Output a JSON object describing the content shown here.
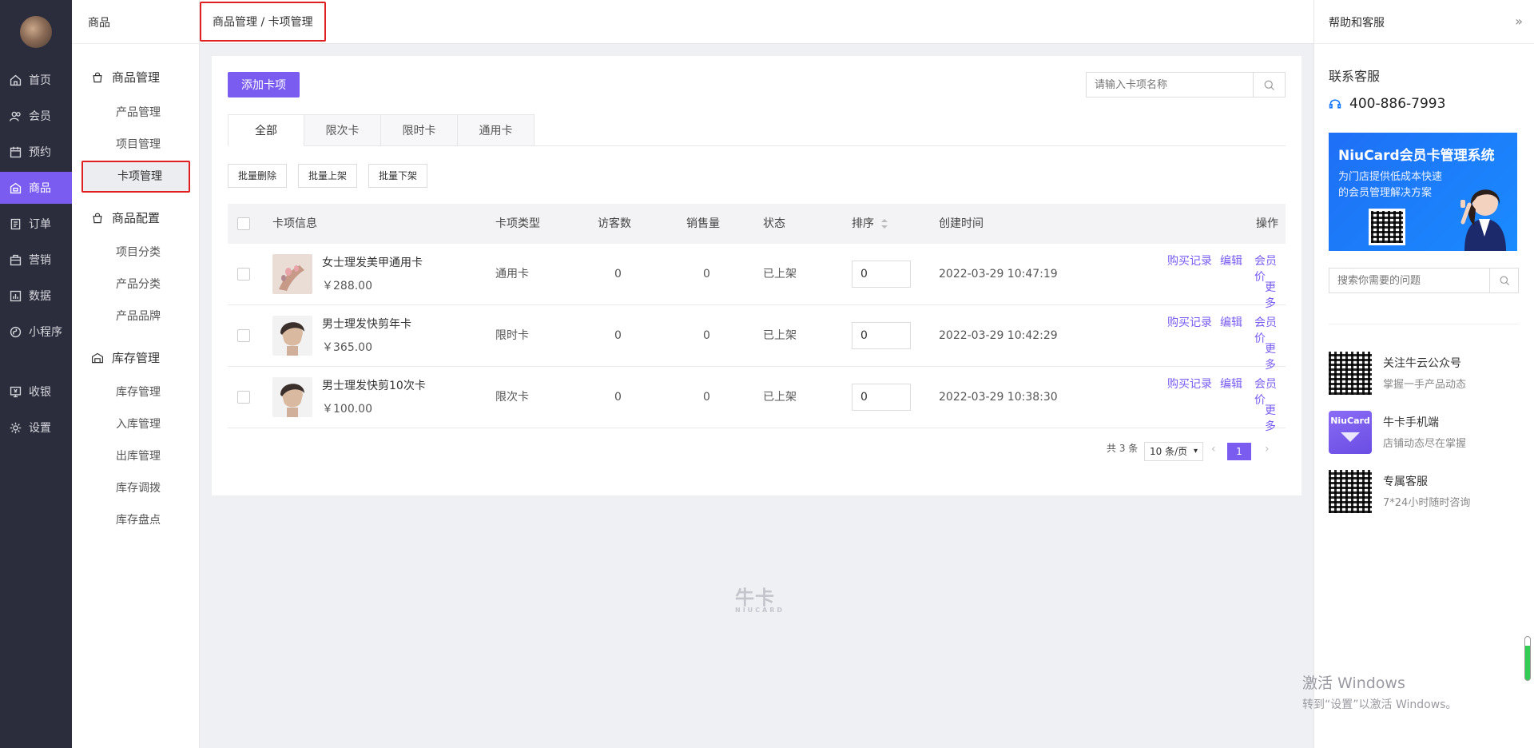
{
  "nav": {
    "items": [
      {
        "label": "首页",
        "icon": "home-icon"
      },
      {
        "label": "会员",
        "icon": "users-icon"
      },
      {
        "label": "预约",
        "icon": "calendar-icon"
      },
      {
        "label": "商品",
        "icon": "store-icon"
      },
      {
        "label": "订单",
        "icon": "order-icon"
      },
      {
        "label": "营销",
        "icon": "marketing-icon"
      },
      {
        "label": "数据",
        "icon": "chart-icon"
      },
      {
        "label": "小程序",
        "icon": "miniapp-icon"
      },
      {
        "label": "收银",
        "icon": "cashier-icon"
      },
      {
        "label": "设置",
        "icon": "gear-icon"
      }
    ],
    "active_color": "#7a5cf0"
  },
  "sidebar": {
    "title": "商品",
    "groups": [
      {
        "label": "商品管理",
        "items": [
          "产品管理",
          "项目管理",
          "卡项管理"
        ]
      },
      {
        "label": "商品配置",
        "items": [
          "项目分类",
          "产品分类",
          "产品品牌"
        ]
      },
      {
        "label": "库存管理",
        "items": [
          "库存管理",
          "入库管理",
          "出库管理",
          "库存调拨",
          "库存盘点"
        ]
      }
    ],
    "active_item": "卡项管理"
  },
  "header": {
    "breadcrumb": "商品管理 / 卡项管理"
  },
  "toolbar": {
    "add_label": "添加卡项",
    "search_placeholder": "请输入卡项名称"
  },
  "tabs": [
    "全部",
    "限次卡",
    "限时卡",
    "通用卡"
  ],
  "bulk": {
    "delete": "批量删除",
    "up": "批量上架",
    "down": "批量下架"
  },
  "table": {
    "headers": {
      "info": "卡项信息",
      "type": "卡项类型",
      "visitors": "访客数",
      "sales": "销售量",
      "status": "状态",
      "sort": "排序",
      "created": "创建时间",
      "ops": "操作"
    },
    "rows": [
      {
        "name": "女士理发美甲通用卡",
        "price": "￥288.00",
        "type": "通用卡",
        "visitors": "0",
        "sales": "0",
        "status": "已上架",
        "sort": "0",
        "created": "2022-03-29 10:47:19"
      },
      {
        "name": "男士理发快剪年卡",
        "price": "￥365.00",
        "type": "限时卡",
        "visitors": "0",
        "sales": "0",
        "status": "已上架",
        "sort": "0",
        "created": "2022-03-29 10:42:29"
      },
      {
        "name": "男士理发快剪10次卡",
        "price": "￥100.00",
        "type": "限次卡",
        "visitors": "0",
        "sales": "0",
        "status": "已上架",
        "sort": "0",
        "created": "2022-03-29 10:38:30"
      }
    ],
    "ops": {
      "records": "购买记录",
      "edit": "编辑",
      "member_price": "会员价",
      "more": "更多"
    }
  },
  "pagination": {
    "total": "共 3 条",
    "page_size": "10 条/页",
    "current": "1",
    "prev": "‹",
    "next": "›"
  },
  "help": {
    "title": "帮助和客服",
    "collapse": "»",
    "contact_title": "联系客服",
    "phone": "400-886-7993",
    "banner_title": "NiuCard会员卡管理系统",
    "banner_line1": "为门店提供低成本快速",
    "banner_line2": "的会员管理解决方案",
    "search_placeholder": "搜索你需要的问题",
    "items": [
      {
        "name": "关注牛云公众号",
        "desc": "掌握一手产品动态"
      },
      {
        "name": "牛卡手机端",
        "desc": "店铺动态尽在掌握",
        "icon_text": "NiuCard"
      },
      {
        "name": "专属客服",
        "desc": "7*24小时随时咨询"
      }
    ]
  },
  "watermark": {
    "text": "牛卡",
    "sub": "NIUCARD"
  },
  "activation": {
    "line1": "激活 Windows",
    "line2": "转到“设置”以激活 Windows。"
  }
}
